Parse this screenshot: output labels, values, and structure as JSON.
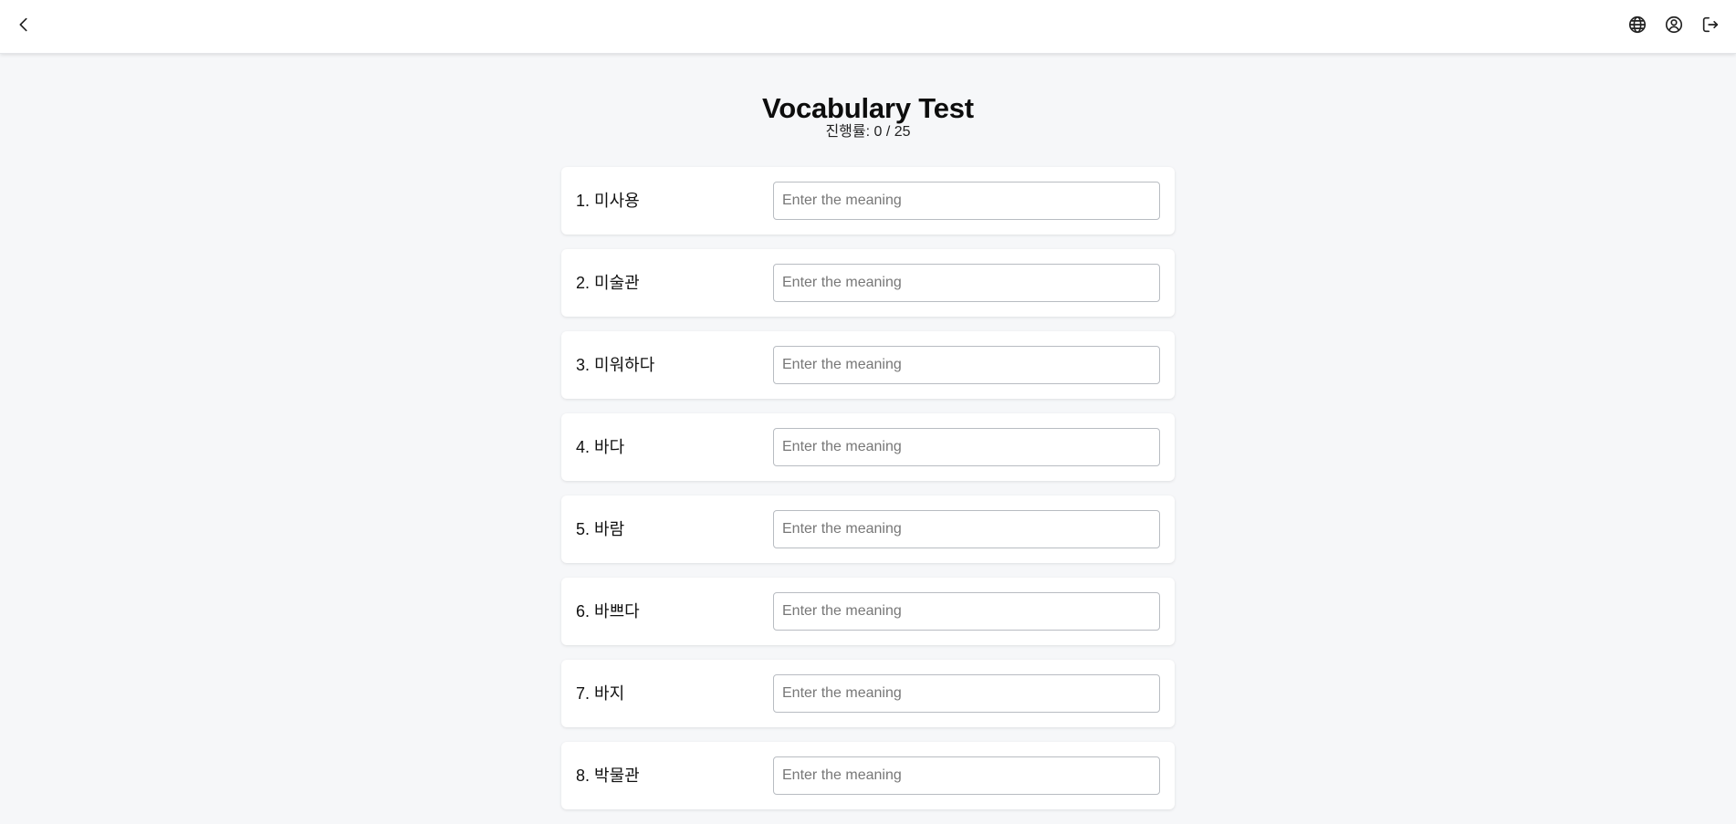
{
  "header": {
    "back_icon": "chevron-left-icon",
    "language_icon": "globe-icon",
    "account_icon": "user-circle-icon",
    "logout_icon": "logout-icon"
  },
  "page": {
    "title": "Vocabulary Test",
    "progress": "진행률: 0 / 25"
  },
  "words": [
    {
      "label": "1. 미사용",
      "value": "",
      "placeholder": "Enter the meaning"
    },
    {
      "label": "2. 미술관",
      "value": "",
      "placeholder": "Enter the meaning"
    },
    {
      "label": "3. 미워하다",
      "value": "",
      "placeholder": "Enter the meaning"
    },
    {
      "label": "4. 바다",
      "value": "",
      "placeholder": "Enter the meaning"
    },
    {
      "label": "5. 바람",
      "value": "",
      "placeholder": "Enter the meaning"
    },
    {
      "label": "6. 바쁘다",
      "value": "",
      "placeholder": "Enter the meaning"
    },
    {
      "label": "7. 바지",
      "value": "",
      "placeholder": "Enter the meaning"
    },
    {
      "label": "8. 박물관",
      "value": "",
      "placeholder": "Enter the meaning"
    }
  ]
}
